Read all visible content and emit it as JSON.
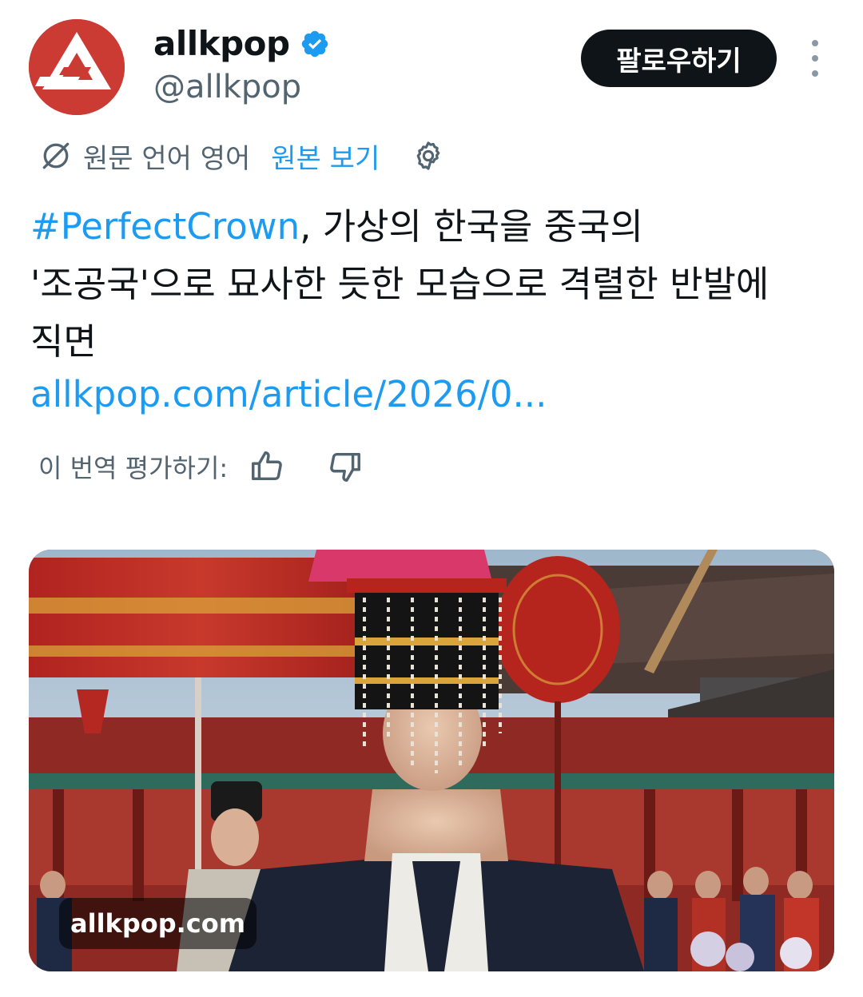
{
  "author": {
    "display_name": "allkpop",
    "handle": "@allkpop",
    "verified": true,
    "avatar_color": "#cc3b33"
  },
  "actions": {
    "follow_label": "팔로우하기",
    "more_icon": "more-vertical-icon"
  },
  "translation": {
    "source_language": "원문 언어 영어",
    "show_original_label": "원본 보기",
    "icon": "translate-icon",
    "settings_icon": "gear-icon"
  },
  "tweet": {
    "hashtag": "#PerfectCrown",
    "body": ", 가상의 한국을 중국의 '조공국'으로 묘사한 듯한 모습으로 격렬한 반발에 직면",
    "link": "allkpop.com/article/2026/0..."
  },
  "rating": {
    "label": "이 번역 평가하기:",
    "thumbs_up_icon": "thumbs-up-icon",
    "thumbs_down_icon": "thumbs-down-icon"
  },
  "media": {
    "domain_label": "allkpop.com",
    "description_icon": "photo-card"
  },
  "colors": {
    "link_blue": "#1d9bf0",
    "text_primary": "#0f1419",
    "text_secondary": "#536471",
    "follow_bg": "#0f1419"
  }
}
